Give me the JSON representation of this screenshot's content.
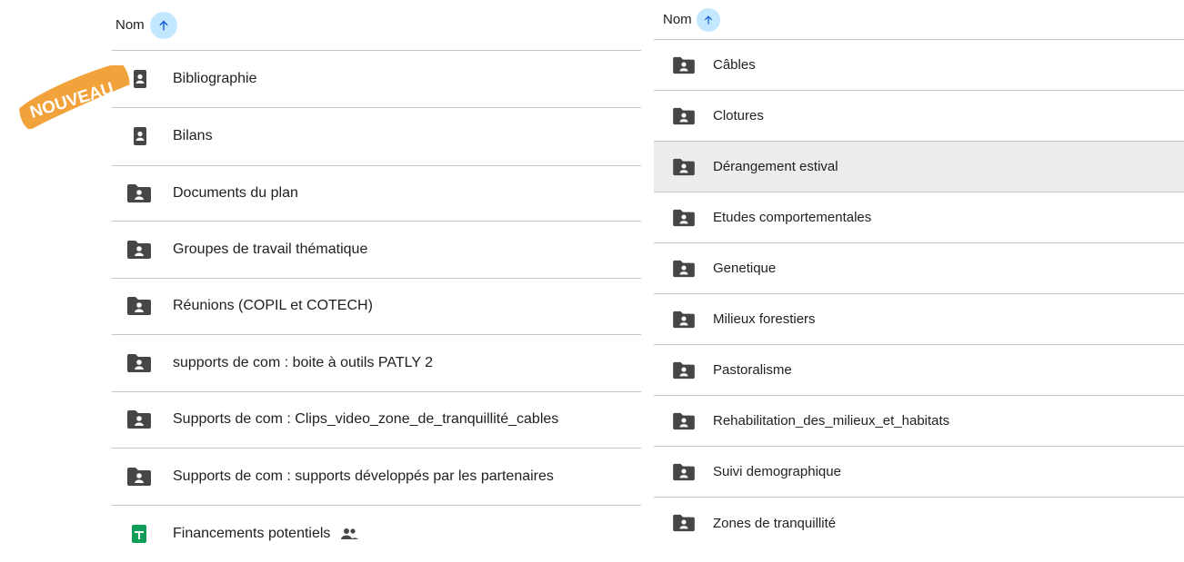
{
  "left": {
    "header": {
      "label": "Nom"
    },
    "rows": [
      {
        "label": "Bibliographie",
        "icon": "shared-folder-icon"
      },
      {
        "label": "Bilans",
        "icon": "shared-folder-icon"
      },
      {
        "label": "Documents du plan",
        "icon": "shared-folder-icon"
      },
      {
        "label": "Groupes de travail thématique",
        "icon": "shared-folder-icon"
      },
      {
        "label": "Réunions (COPIL et COTECH)",
        "icon": "shared-folder-icon"
      },
      {
        "label": "supports de com : boite à outils PATLY 2",
        "icon": "shared-folder-icon"
      },
      {
        "label": "Supports de com : Clips_video_zone_de_tranquillité_cables",
        "icon": "shared-folder-icon"
      },
      {
        "label": "Supports de com : supports développés par les partenaires",
        "icon": "shared-folder-icon"
      },
      {
        "label": "Financements potentiels",
        "icon": "google-sheets-icon",
        "shared": "people-icon"
      }
    ]
  },
  "right": {
    "header": {
      "label": "Nom"
    },
    "rows": [
      {
        "label": "Câbles",
        "icon": "shared-folder-icon"
      },
      {
        "label": "Clotures",
        "icon": "shared-folder-icon"
      },
      {
        "label": "Dérangement estival",
        "icon": "shared-folder-icon"
      },
      {
        "label": "Etudes comportementales",
        "icon": "shared-folder-icon"
      },
      {
        "label": "Genetique",
        "icon": "shared-folder-icon"
      },
      {
        "label": "Milieux forestiers",
        "icon": "shared-folder-icon"
      },
      {
        "label": "Pastoralisme",
        "icon": "shared-folder-icon"
      },
      {
        "label": "Rehabilitation_des_milieux_et_habitats",
        "icon": "shared-folder-icon"
      },
      {
        "label": "Suivi demographique",
        "icon": "shared-folder-icon"
      },
      {
        "label": "Zones de tranquillité",
        "icon": "shared-folder-icon"
      }
    ]
  },
  "badge": {
    "text": "NOUVEAU",
    "color": "#f2a23a"
  },
  "colors": {
    "sort_bg": "#c2e7ff",
    "folder": "#444746",
    "sheets_green": "#0f9d58",
    "row_selected_bg": "#ececec",
    "divider": "#c7c7c7"
  }
}
